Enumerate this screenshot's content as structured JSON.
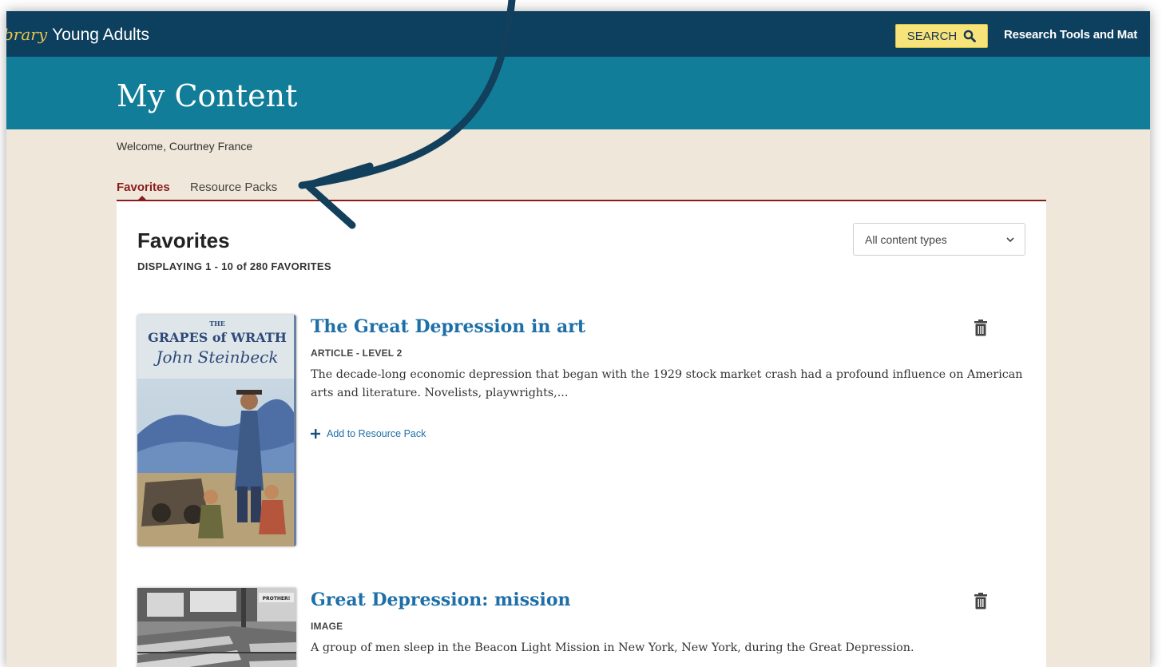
{
  "header": {
    "brand_script": "brary",
    "brand_name": "Young Adults",
    "search_label": "SEARCH",
    "research_link": "Research Tools and Mat"
  },
  "hero": {
    "title": "My Content"
  },
  "welcome": "Welcome, Courtney France",
  "tabs": [
    {
      "label": "Favorites",
      "active": true
    },
    {
      "label": "Resource Packs",
      "active": false
    }
  ],
  "panel": {
    "title": "Favorites",
    "count_label": "DISPLAYING 1 - 10 of 280 FAVORITES",
    "filter": {
      "selected": "All content types"
    }
  },
  "items": [
    {
      "title": "The Great Depression in art",
      "type": "ARTICLE - LEVEL 2",
      "description": "The decade-long economic depression that began with the 1929 stock market crash had a profound influence on American arts and literature. Novelists, playwrights,...",
      "add_label": "Add to Resource Pack",
      "thumb": {
        "line1": "THE",
        "line2": "GRAPES of WRATH",
        "line3": "John Steinbeck"
      }
    },
    {
      "title": "Great Depression: mission",
      "type": "IMAGE",
      "description": "A group of men sleep in the Beacon Light Mission in New York, New York, during the Great Depression.",
      "thumb": {
        "sign": "PROTHER!"
      }
    }
  ],
  "icons": {
    "search": "search-icon",
    "chevron": "chevron-down-icon",
    "plus": "plus-icon",
    "trash": "trash-icon",
    "annotation": "curved-arrow-icon"
  },
  "colors": {
    "topbar": "#0d3f5e",
    "hero": "#127d98",
    "background": "#efe7da",
    "accent_red": "#8a1c1c",
    "link_blue": "#1d6fa8",
    "search_yellow": "#f6e47a",
    "brand_gold": "#e6c54a"
  }
}
